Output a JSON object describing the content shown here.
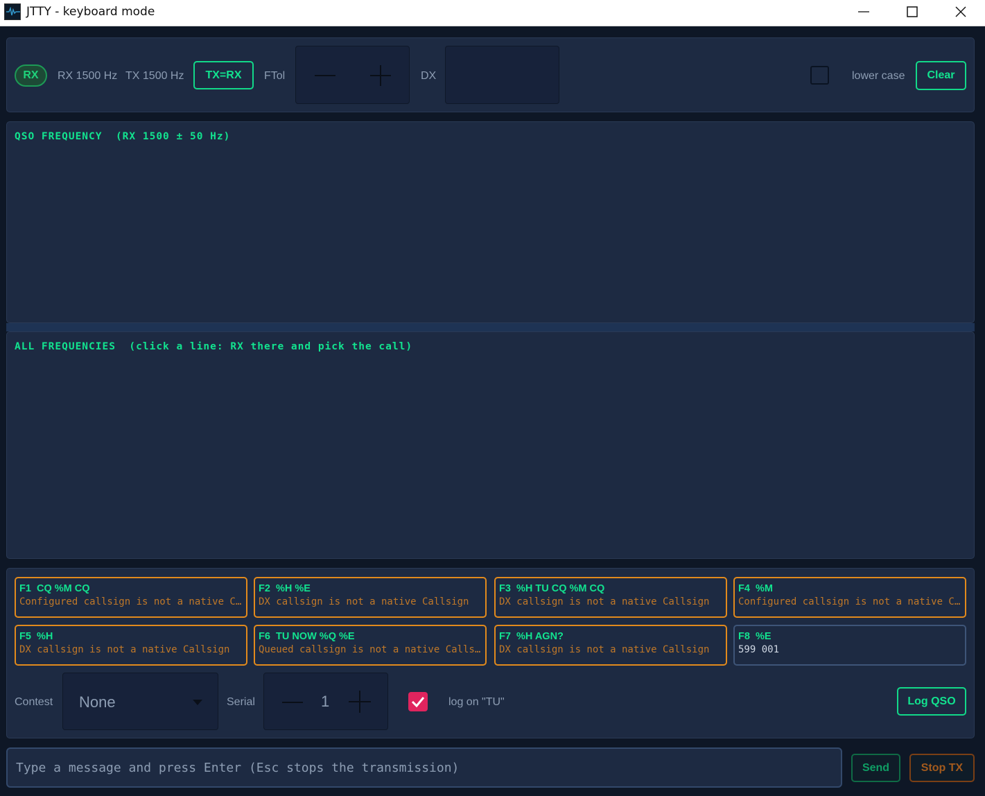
{
  "window": {
    "title": "JTTY - keyboard mode"
  },
  "toolbar": {
    "rx_label": "RX",
    "rx_freq": "RX 1500 Hz",
    "tx_freq": "TX 1500 Hz",
    "txrx_button": "TX=RX",
    "ftol_label": "FTol",
    "dx_label": "DX",
    "lower_case_label": "lower case",
    "clear_button": "Clear"
  },
  "qso_section": {
    "title": "QSO FREQUENCY  (RX 1500 ± 50 Hz)"
  },
  "all_section": {
    "title": "ALL FREQUENCIES  (click a line: RX there and pick the call)"
  },
  "macros": [
    {
      "title": "F1  CQ %M CQ",
      "subtitle": "Configured callsign is not a native Callsign"
    },
    {
      "title": "F2  %H %E",
      "subtitle": "DX callsign is not a native Callsign"
    },
    {
      "title": "F3  %H TU CQ %M CQ",
      "subtitle": "DX callsign is not a native Callsign"
    },
    {
      "title": "F4  %M",
      "subtitle": "Configured callsign is not a native Callsign"
    },
    {
      "title": "F5  %H",
      "subtitle": "DX callsign is not a native Callsign"
    },
    {
      "title": "F6  TU NOW %Q %E",
      "subtitle": "Queued callsign is not a native Callsign"
    },
    {
      "title": "F7  %H AGN?",
      "subtitle": "DX callsign is not a native Callsign"
    },
    {
      "title": "F8  %E",
      "subtitle": "599 001"
    }
  ],
  "bottom_controls": {
    "contest_label": "Contest",
    "contest_value": "None",
    "serial_label": "Serial",
    "serial_value": "1",
    "log_on_tu_label": "log on \"TU\"",
    "log_qso_button": "Log QSO"
  },
  "message": {
    "placeholder": "Type a message and press Enter (Esc stops the transmission)",
    "send_button": "Send",
    "stop_button": "Stop TX"
  },
  "colors": {
    "accent_green": "#12e38f",
    "macro_orange": "#e28a1c",
    "stop_orange": "#c5621e",
    "checkbox_pink": "#e0245e",
    "panel_bg": "#1d2a42",
    "window_bg": "#0e1726"
  }
}
